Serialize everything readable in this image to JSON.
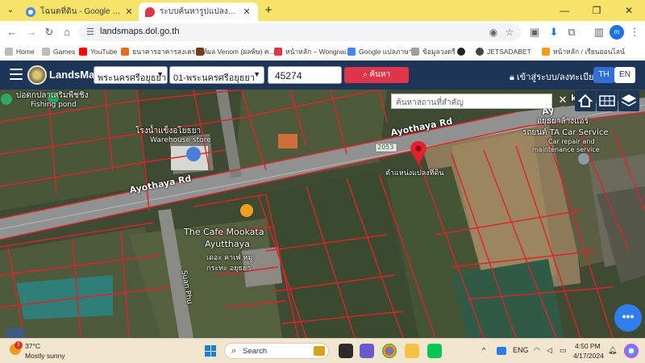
{
  "browser": {
    "tabs": [
      {
        "title": "โฉนดที่ดิน - Google Search",
        "favicon_color": "#4285f4",
        "active": false
      },
      {
        "title": "ระบบค้นหารูปแปลงที่ดิน (LandsMaps)",
        "favicon_color": "#e0344a",
        "active": true
      }
    ],
    "new_tab_label": "+",
    "window_controls": {
      "minimize": "—",
      "restore": "❐",
      "close": "✕"
    },
    "url": "landsmaps.dol.go.th",
    "bookmarks": [
      {
        "label": "Home",
        "color": "#777777"
      },
      {
        "label": "Games",
        "color": "#777777"
      },
      {
        "label": "YouTube",
        "color": "#ff0000"
      },
      {
        "label": "ธนาคารอาคารสงเคราะห์",
        "color": "#e36b1d"
      },
      {
        "label": "ผล Venom (ผลพิษ) ค...",
        "color": "#7a3b1d"
      },
      {
        "label": "หน้าหลัก – Wongnai...",
        "color": "#e0344a"
      },
      {
        "label": "Google แปลภาษา",
        "color": "#4285f4"
      },
      {
        "label": "ข้อมูลวงดรี",
        "color": "#777777"
      },
      {
        "label": "",
        "color": "#222222"
      },
      {
        "label": "JETSADABET",
        "color": "#444444"
      },
      {
        "label": "หน้าหลัก / เรียนออนไลน์",
        "color": "#f29b1d"
      }
    ]
  },
  "app": {
    "brand": "LandsMaps",
    "province": "พระนครศรีอยุธยา",
    "district": "01-พระนครศรีอยุธยา",
    "parcel_number": "45274",
    "search_button": "ค้นหา",
    "login_label": "เข้าสู่ระบบ/ลงทะเบียน",
    "lang_th": "TH",
    "lang_en": "EN",
    "place_search_placeholder": "ค้นหาสถานที่สำคัญ",
    "clear_label": "✕",
    "fab_label": "•••",
    "colors": {
      "header": "#1d3557",
      "search_button": "#e0344a",
      "parcel_line": "#e3202b",
      "lang_active": "#2f6fd6"
    }
  },
  "map": {
    "labels": {
      "road_main": "Ayothaya Rd",
      "road_right": "Ayothaya Rd",
      "road_cut": "Ay",
      "road_side": "Suan Phu",
      "route_number": "2053",
      "pin_label": "ตำแหน่งแปลงที่ดิน",
      "warehouse_th": "โรงน้ำแข็งอโยธยา",
      "warehouse_en": "Warehouse store",
      "fishing_th": "บ่อตกปลาเสริมพืชชิง",
      "fishing_en": "Fishing pond",
      "cafe_en": "The Cafe Mookata",
      "cafe_en2": "Ayutthaya",
      "cafe_th": "เดอะ คาเฟ่ หมู",
      "cafe_th2": "กระทะ อยุธยา",
      "carservice_th": "อยุธยาล้างแอร์",
      "carservice_en": "รถยนต์ TA Car Service",
      "carservice_en2": "Car repair and",
      "carservice_en3": "maintenance service",
      "cut_left": "k"
    }
  },
  "taskbar": {
    "weather_badge": "1",
    "temperature": "37°C",
    "condition": "Mostly sunny",
    "search_label": "Search",
    "tray_caret": "^",
    "language": "ENG",
    "time": "4:50 PM",
    "date": "4/17/2024"
  }
}
